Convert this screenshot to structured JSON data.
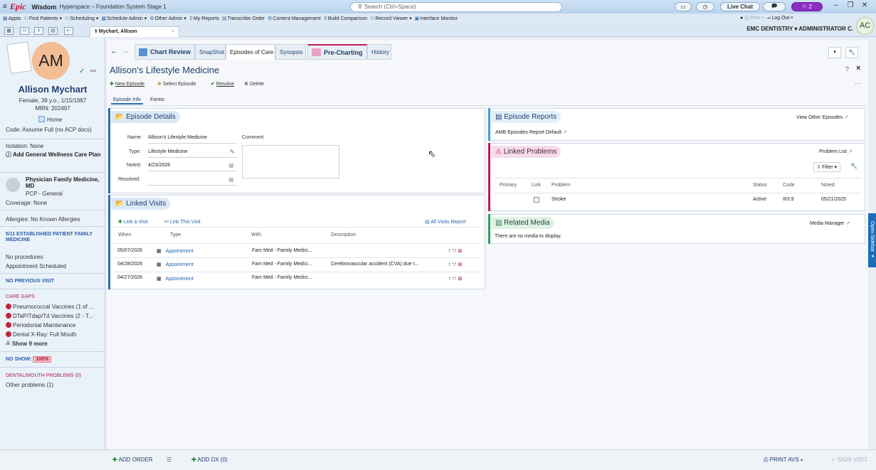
{
  "title_bar": {
    "logo": "Epic",
    "app": "Wisdom",
    "app_suffix": "Hyperspace – Foundation System Stage 1",
    "search_placeholder": "Search (Ctrl+Space)",
    "live_chat": "Live Chat",
    "notif_count": "2"
  },
  "activity_toolbar": [
    "Appts",
    "Find Patients",
    "Scheduling",
    "Schedule Admin",
    "Other Admin",
    "My Reports",
    "Transcribe Order",
    "Content Management",
    "Build Comparison",
    "Record Viewer",
    "Interface Monitor"
  ],
  "header_right": {
    "print": "Print",
    "log_out": "Log Out",
    "dept": "EMC DENTISTRY",
    "user": "ADMINISTRATOR C.",
    "avatar": "AC"
  },
  "patient_tab": {
    "label": "Mychart, Allison",
    "close": "×"
  },
  "sidebar": {
    "avatar": "AM",
    "name": "Allison Mychart",
    "demographics": "Female, 39 y.o., 1/15/1987",
    "mrn": "MRN: 202497",
    "home": "Home",
    "code": "Code: Assume Full (no ACP docs)",
    "isolation": "Isolation: None",
    "wellness": "Add General Wellness Care Plan",
    "pcp_name": "Physician Family Medicine, MD",
    "pcp_role": "PCP - General",
    "coverage": "Coverage: None",
    "allergies": "Allergies: No Known Allergies",
    "established": "5/11 ESTABLISHED PATIENT FAMILY MEDICINE",
    "no_procedures": "No procedures",
    "appt_scheduled": "Appointment Scheduled",
    "no_previous_visit": "NO PREVIOUS VISIT",
    "care_gaps_title": "CARE GAPS",
    "care_gaps": [
      "Pneumococcal Vaccines (1 of ...",
      "DTaP/Tdap/Td Vaccines (2 - T...",
      "Periodontal Maintenance",
      "Dental X-Ray: Full Mouth"
    ],
    "show_more": "Show 9 more",
    "no_show_label": "NO SHOW:",
    "no_show_value": "100%",
    "dental_problems": "DENTAL/MOUTH PROBLEMS (0)",
    "other_problems": "Other problems (1)"
  },
  "activity_tabs": [
    "Chart Review",
    "SnapShot",
    "Episodes of Care",
    "Synopsis",
    "Pre-Charting",
    "History"
  ],
  "page": {
    "title": "Allison's Lifestyle Medicine",
    "new_episode": "New Episode",
    "select_episode": "Select Episode",
    "resolve": "Resolve",
    "delete": "Delete",
    "sub_tabs": [
      "Episode Info",
      "Forms"
    ]
  },
  "episode_details": {
    "title": "Episode Details",
    "name_label": "Name:",
    "name_value": "Allison's Lifestyle Medicine",
    "comment_label": "Comment",
    "type_label": "Type:",
    "type_value": "Lifestyle Medicine",
    "noted_label": "Noted:",
    "noted_value": "4/23/2026",
    "resolved_label": "Resolved:"
  },
  "linked_visits": {
    "title": "Linked Visits",
    "link_a_visit": "Link a Visit",
    "link_this_visit": "Link This Visit",
    "all_visits_report": "All Visits Report",
    "headers": [
      "When",
      "Type",
      "With",
      "Description"
    ],
    "rows": [
      {
        "when": "05/07/2026",
        "type": "Appointment",
        "with": "Fam Med - Family Medici...",
        "description": ""
      },
      {
        "when": "04/28/2026",
        "type": "Appointment",
        "with": "Fam Med - Family Medici...",
        "description": "Cerebrovascular accident (CVA) due t..."
      },
      {
        "when": "04/27/2026",
        "type": "Appointment",
        "with": "Fam Med - Family Medici...",
        "description": ""
      }
    ]
  },
  "episode_reports": {
    "title": "Episode Reports",
    "view_other": "View Other Episodes",
    "report": "AMB Episodes Report Default"
  },
  "linked_problems": {
    "title": "Linked Problems",
    "problem_list": "Problem List",
    "filter": "Filter",
    "headers": [
      "Primary",
      "Link",
      "Problem",
      "Status",
      "Code",
      "Noted"
    ],
    "rows": [
      {
        "primary": "",
        "link": "",
        "problem": "Stroke",
        "status": "Active",
        "code": "I63.9",
        "noted": "05/21/2025"
      }
    ]
  },
  "related_media": {
    "title": "Related Media",
    "media_manager": "Media Manager",
    "empty": "There are no media to display."
  },
  "bottom": {
    "add_order": "ADD ORDER",
    "add_dx": "ADD DX (0)",
    "print_avs": "PRINT AVS",
    "sign_visit": "SIGN VISIT",
    "open_sidebar": "Open Sidebar"
  }
}
